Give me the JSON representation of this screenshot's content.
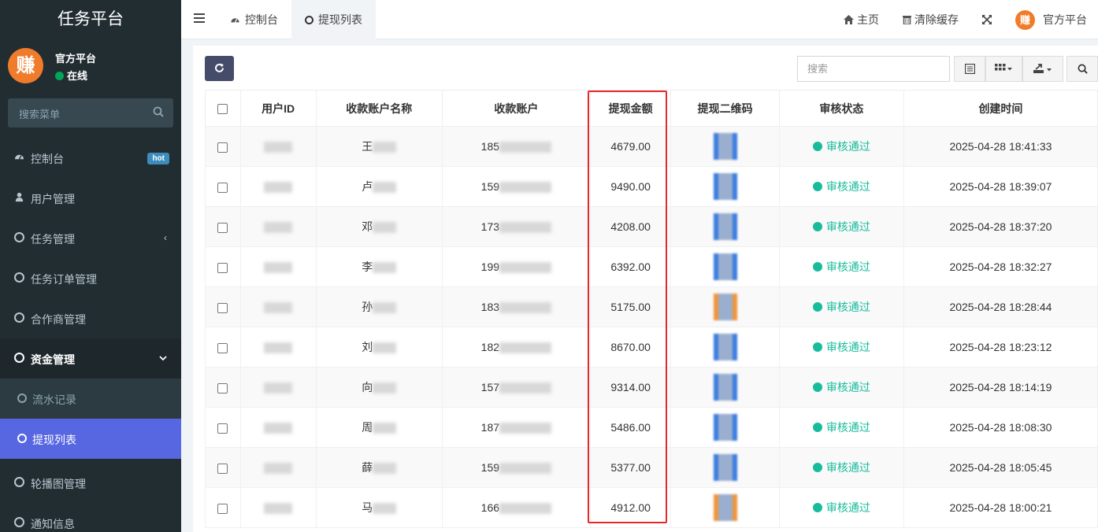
{
  "sidebar": {
    "app_title": "任务平台",
    "user_name": "官方平台",
    "user_status": "在线",
    "avatar_text": "赚",
    "search_placeholder": "搜索菜单",
    "hot_badge": "hot",
    "items": [
      {
        "label": "控制台",
        "icon": "dashboard-icon"
      },
      {
        "label": "用户管理",
        "icon": "user-icon"
      },
      {
        "label": "任务管理",
        "icon": "circle-icon"
      },
      {
        "label": "任务订单管理",
        "icon": "circle-icon"
      },
      {
        "label": "合作商管理",
        "icon": "circle-icon"
      },
      {
        "label": "资金管理",
        "icon": "circle-icon"
      },
      {
        "label": "轮播图管理",
        "icon": "circle-icon"
      },
      {
        "label": "通知信息",
        "icon": "circle-icon"
      }
    ],
    "sub_items": [
      {
        "label": "流水记录"
      },
      {
        "label": "提现列表"
      }
    ]
  },
  "topbar": {
    "tabs": [
      {
        "label": "控制台"
      },
      {
        "label": "提现列表"
      }
    ],
    "home_label": "主页",
    "clear_cache_label": "清除缓存",
    "user_label": "官方平台",
    "avatar_text": "赚"
  },
  "toolbar": {
    "search_placeholder": "搜索"
  },
  "table": {
    "columns": [
      "用户ID",
      "收款账户名称",
      "收款账户",
      "提现金额",
      "提现二维码",
      "审核状态",
      "创建时间"
    ],
    "rows": [
      {
        "name": "王",
        "account": "185",
        "amount": "4679.00",
        "status": "审核通过",
        "time": "2025-04-28 18:41:33",
        "qr_color": "#3b7de0"
      },
      {
        "name": "卢",
        "account": "159",
        "amount": "9490.00",
        "status": "审核通过",
        "time": "2025-04-28 18:39:07",
        "qr_color": "#3b7de0"
      },
      {
        "name": "邓",
        "account": "173",
        "amount": "4208.00",
        "status": "审核通过",
        "time": "2025-04-28 18:37:20",
        "qr_color": "#3b7de0"
      },
      {
        "name": "李",
        "account": "199",
        "amount": "6392.00",
        "status": "审核通过",
        "time": "2025-04-28 18:32:27",
        "qr_color": "#3b7de0"
      },
      {
        "name": "孙",
        "account": "183",
        "amount": "5175.00",
        "status": "审核通过",
        "time": "2025-04-28 18:28:44",
        "qr_color": "#f0953b"
      },
      {
        "name": "刘",
        "account": "182",
        "amount": "8670.00",
        "status": "审核通过",
        "time": "2025-04-28 18:23:12",
        "qr_color": "#3b7de0"
      },
      {
        "name": "向",
        "account": "157",
        "amount": "9314.00",
        "status": "审核通过",
        "time": "2025-04-28 18:14:19",
        "qr_color": "#3b7de0"
      },
      {
        "name": "周",
        "account": "187",
        "amount": "5486.00",
        "status": "审核通过",
        "time": "2025-04-28 18:08:30",
        "qr_color": "#3b7de0"
      },
      {
        "name": "薛",
        "account": "159",
        "amount": "5377.00",
        "status": "审核通过",
        "time": "2025-04-28 18:05:45",
        "qr_color": "#3b7de0"
      },
      {
        "name": "马",
        "account": "166",
        "amount": "4912.00",
        "status": "审核通过",
        "time": "2025-04-28 18:00:21",
        "qr_color": "#f0953b"
      }
    ]
  },
  "colors": {
    "sidebar_bg": "#222d32",
    "active_item": "#5766e1",
    "status_green": "#18bc9c",
    "highlight_red": "#e8272b"
  }
}
